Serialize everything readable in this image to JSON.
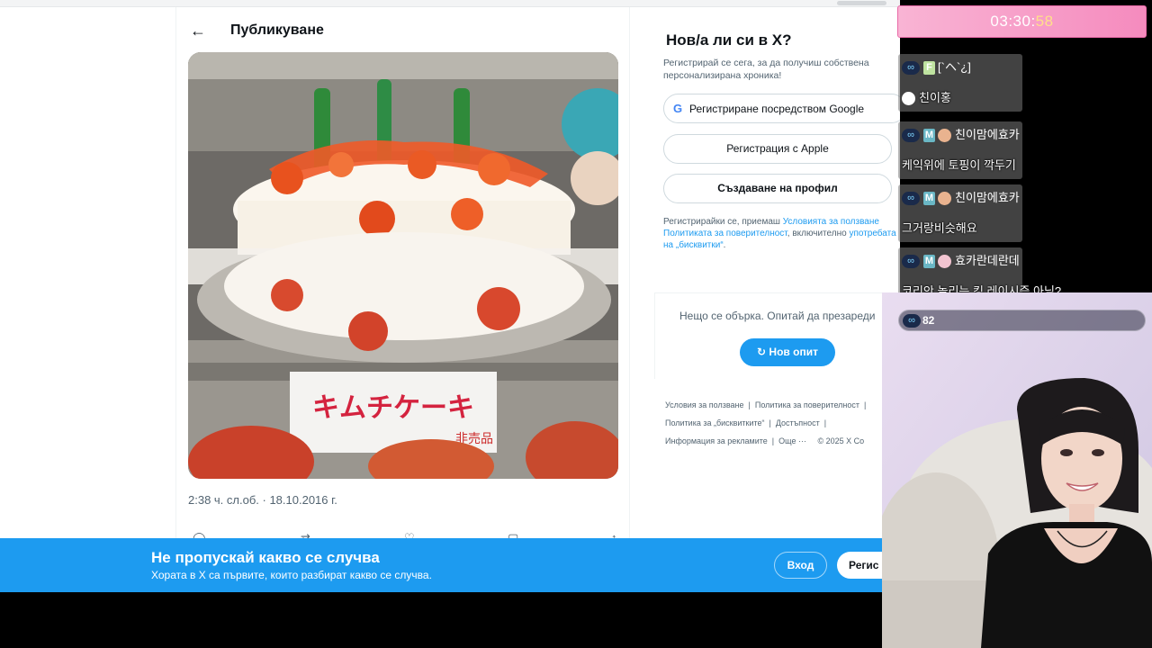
{
  "post": {
    "back_icon": "arrow-left-icon",
    "title": "Публикуване",
    "image_sign_text": "キムチケーキ",
    "image_sub_text": "非売品",
    "timestamp": "2:38 ч. сл.об. · 18.10.2016 г."
  },
  "sidebar": {
    "new_title": "Нов/а ли си в X?",
    "new_sub": "Регистрирай се сега, за да получиш собствена персонализирана хроника!",
    "google_btn": "Регистриране посредством Google",
    "apple_btn": "Регистрация с Apple",
    "profile_btn": "Създаване на профил",
    "terms_prefix": "Регистрирайки се, приемаш",
    "terms_link": "Условията за ползване",
    "privacy_link": "Политиката за поверителност",
    "terms_mid": ", включително",
    "cookies_link": "употребата на „бисквитки“",
    "terms_end": ".",
    "error_text": "Нещо се обърка. Опитай да презареди",
    "retry_btn": "Нов опит",
    "footer": {
      "terms": "Условия за ползване",
      "privacy": "Политика за поверителност",
      "cookies": "Политика за „бисквитките“",
      "accessibility": "Достъпност",
      "ads": "Информация за рекламите",
      "more": "Още ···",
      "copyright": "© 2025 X Co"
    }
  },
  "banner": {
    "title": "Не пропускай какво се случва",
    "subtitle": "Хората в X са първите, които разбират какво се случва.",
    "login_btn": "Вход",
    "signup_btn": "Регис"
  },
  "stream": {
    "timer_main": "03:30:",
    "timer_sec": "58",
    "chat": [
      {
        "tag": "F",
        "user": "[`ヘ`¿]",
        "text": "친이홍"
      },
      {
        "tag": "M",
        "user": "친이맘에효카",
        "text": "케익위에 토핑이 깍두기"
      },
      {
        "tag": "M",
        "user": "친이맘에효카",
        "text": "그거랑비슷해요"
      },
      {
        "tag": "M",
        "user": "효카란데란데",
        "text": "코리안 놀리는    킹 레이시즘 아님?"
      }
    ],
    "viewer_count": "82"
  },
  "colors": {
    "x_blue": "#1d9bf0",
    "timer_pink": "#f58bbe"
  }
}
